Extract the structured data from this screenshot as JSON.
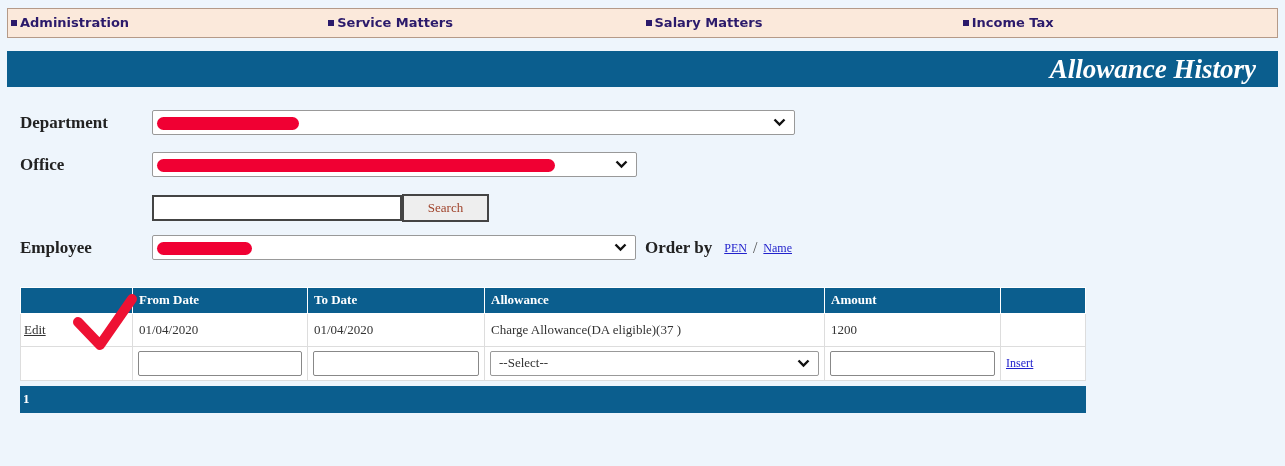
{
  "nav": [
    "Administration",
    "Service Matters",
    "Salary Matters",
    "Income Tax"
  ],
  "title": "Allowance History",
  "form": {
    "department": {
      "label": "Department"
    },
    "office": {
      "label": "Office"
    },
    "search_button": "Search",
    "employee": {
      "label": "Employee"
    },
    "order_by": {
      "label": "Order by",
      "links": [
        "PEN",
        "Name"
      ],
      "separator": "/"
    }
  },
  "table": {
    "columns": [
      "From Date",
      "To Date",
      "Allowance",
      "Amount"
    ],
    "rows": [
      {
        "action": "Edit",
        "from": "01/04/2020",
        "to": "01/04/2020",
        "allowance": "Charge Allowance(DA eligible)(37 )",
        "amount": "1200"
      }
    ],
    "new_row": {
      "allowance_select": "--Select--",
      "action": "Insert"
    },
    "pager": "1"
  }
}
